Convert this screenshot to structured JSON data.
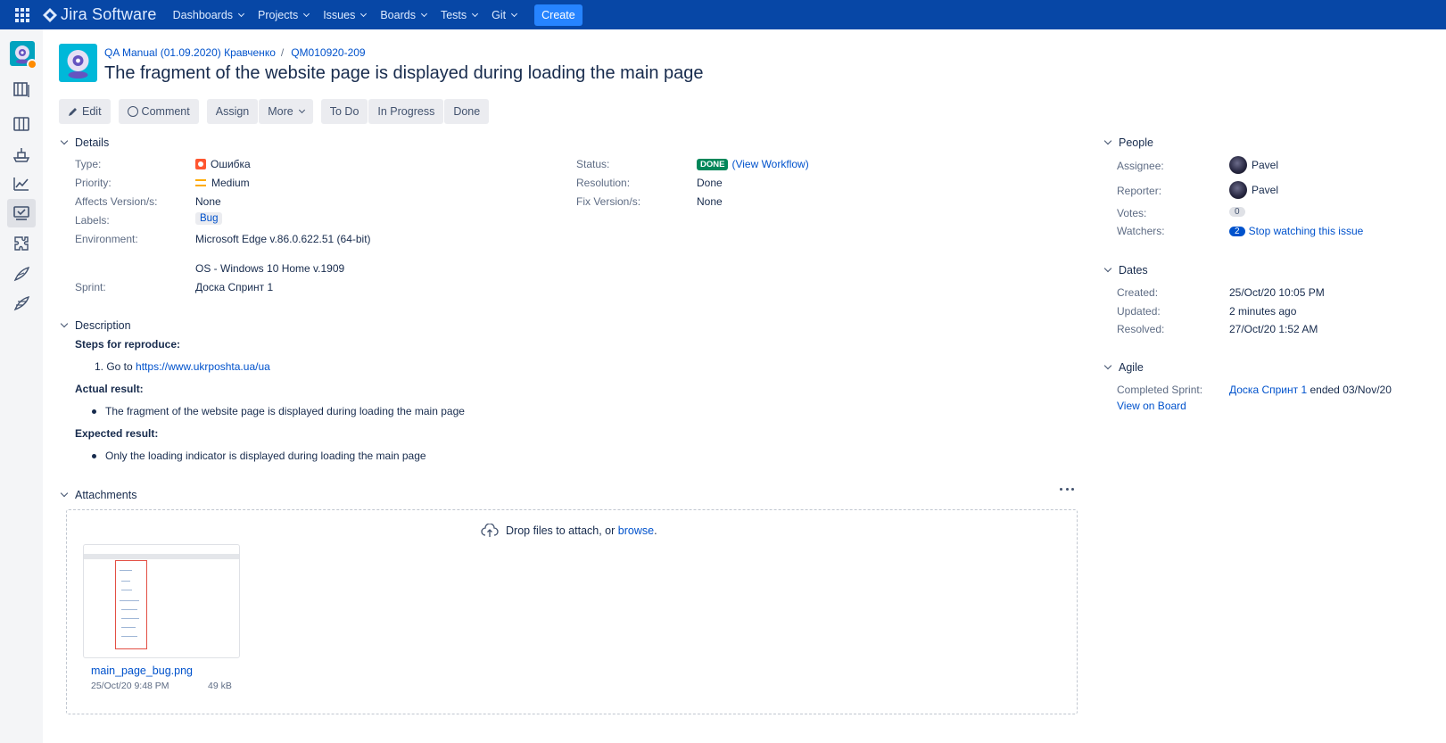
{
  "topnav": {
    "logo_text": "Jira Software",
    "items": [
      "Dashboards",
      "Projects",
      "Issues",
      "Boards",
      "Tests",
      "Git"
    ],
    "create_label": "Create"
  },
  "breadcrumb": {
    "project": "QA Manual (01.09.2020) Кравченко",
    "separator": "/",
    "issue_key": "QM010920-209"
  },
  "issue": {
    "title": "The fragment of the website page is displayed during loading the main page"
  },
  "toolbar": {
    "edit": "Edit",
    "comment": "Comment",
    "assign": "Assign",
    "more": "More",
    "todo": "To Do",
    "in_progress": "In Progress",
    "done": "Done"
  },
  "details": {
    "heading": "Details",
    "type_label": "Type:",
    "type_value": "Ошибка",
    "priority_label": "Priority:",
    "priority_value": "Medium",
    "affects_label": "Affects Version/s:",
    "affects_value": "None",
    "labels_label": "Labels:",
    "labels_value": "Bug",
    "env_label": "Environment:",
    "env_line1": "Microsoft Edge v.86.0.622.51 (64-bit)",
    "env_line2": "OS - Windows 10 Home v.1909",
    "sprint_label": "Sprint:",
    "sprint_value": "Доска Спринт 1",
    "status_label": "Status:",
    "status_value": "DONE",
    "workflow_link": "(View Workflow)",
    "resolution_label": "Resolution:",
    "resolution_value": "Done",
    "fix_label": "Fix Version/s:",
    "fix_value": "None"
  },
  "description": {
    "heading": "Description",
    "steps_heading": "Steps for reproduce:",
    "step1_prefix": "1. Go to",
    "step1_link": "https://www.ukrposhta.ua/ua",
    "actual_heading": "Actual result:",
    "actual_item": "The fragment of the website page is displayed during loading the main page",
    "expected_heading": "Expected result:",
    "expected_item": "Only the loading indicator is displayed during loading the main page"
  },
  "attachments": {
    "heading": "Attachments",
    "drop_text": "Drop files to attach, or",
    "browse": "browse",
    "drop_period": ".",
    "file_name": "main_page_bug.png",
    "file_date": "25/Oct/20 9:48 PM",
    "file_size": "49 kB"
  },
  "people": {
    "heading": "People",
    "assignee_label": "Assignee:",
    "assignee": "Pavel",
    "reporter_label": "Reporter:",
    "reporter": "Pavel",
    "votes_label": "Votes:",
    "votes": "0",
    "watchers_label": "Watchers:",
    "watchers": "2",
    "watch_link": "Stop watching this issue"
  },
  "dates": {
    "heading": "Dates",
    "created_label": "Created:",
    "created": "25/Oct/20 10:05 PM",
    "updated_label": "Updated:",
    "updated": "2 minutes ago",
    "resolved_label": "Resolved:",
    "resolved": "27/Oct/20 1:52 AM"
  },
  "agile": {
    "heading": "Agile",
    "completed_label": "Completed Sprint:",
    "sprint_link": "Доска Спринт 1",
    "sprint_suffix": "ended 03/Nov/20",
    "view_board": "View on Board"
  },
  "colors": {
    "nav_bg": "#0747a6",
    "create_btn": "#2684ff",
    "link": "#0052cc",
    "done_lozenge": "#00875a",
    "bug_type": "#ff5630",
    "priority_medium": "#ffab00"
  },
  "icons": [
    "app-switcher-icon",
    "jira-logo-icon",
    "project-avatar-icon",
    "backlog-icon",
    "board-icon",
    "releases-icon",
    "reports-icon",
    "tests-icon",
    "addons-icon",
    "feather-icon",
    "feather-alt-icon",
    "pencil-icon",
    "comment-icon",
    "bug-type-icon",
    "priority-medium-icon",
    "upload-cloud-icon",
    "more-icon"
  ]
}
